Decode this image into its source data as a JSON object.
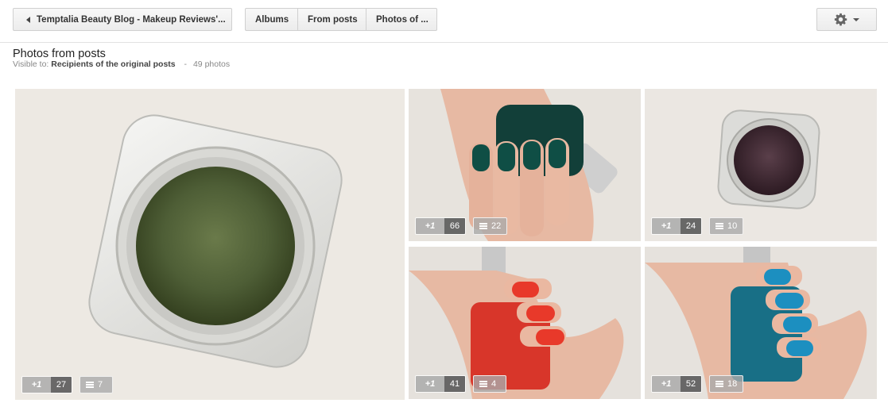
{
  "topbar": {
    "back_label": "Temptalia Beauty Blog - Makeup Reviews'...",
    "tabs": [
      {
        "label": "Albums"
      },
      {
        "label": "From posts"
      },
      {
        "label": "Photos of ..."
      }
    ],
    "settings_icon": "gear-icon"
  },
  "header": {
    "title": "Photos from posts",
    "visible_to_label": "Visible to:",
    "visible_to_value": "Recipients of the original posts",
    "separator": "-",
    "photo_count": "49 photos"
  },
  "photos": [
    {
      "subject": "green-eyeshadow-pot",
      "plus_label": "+1",
      "plus_count": "27",
      "comment_count": "7"
    },
    {
      "subject": "teal-nail-polish-hand",
      "plus_label": "+1",
      "plus_count": "66",
      "comment_count": "22"
    },
    {
      "subject": "plum-eyeshadow-pot",
      "plus_label": "+1",
      "plus_count": "24",
      "comment_count": "10"
    },
    {
      "subject": "red-nail-polish-hand",
      "plus_label": "+1",
      "plus_count": "41",
      "comment_count": "4"
    },
    {
      "subject": "blue-nail-polish-hand",
      "plus_label": "+1",
      "plus_count": "52",
      "comment_count": "18"
    }
  ],
  "colors": {
    "green_shadow": "#4e5e36",
    "plum_shadow": "#3b2630",
    "teal_polish": "#0f4e45",
    "red_polish": "#e8392a",
    "blue_polish": "#1c8fc0",
    "skin": "#e7b9a3"
  }
}
